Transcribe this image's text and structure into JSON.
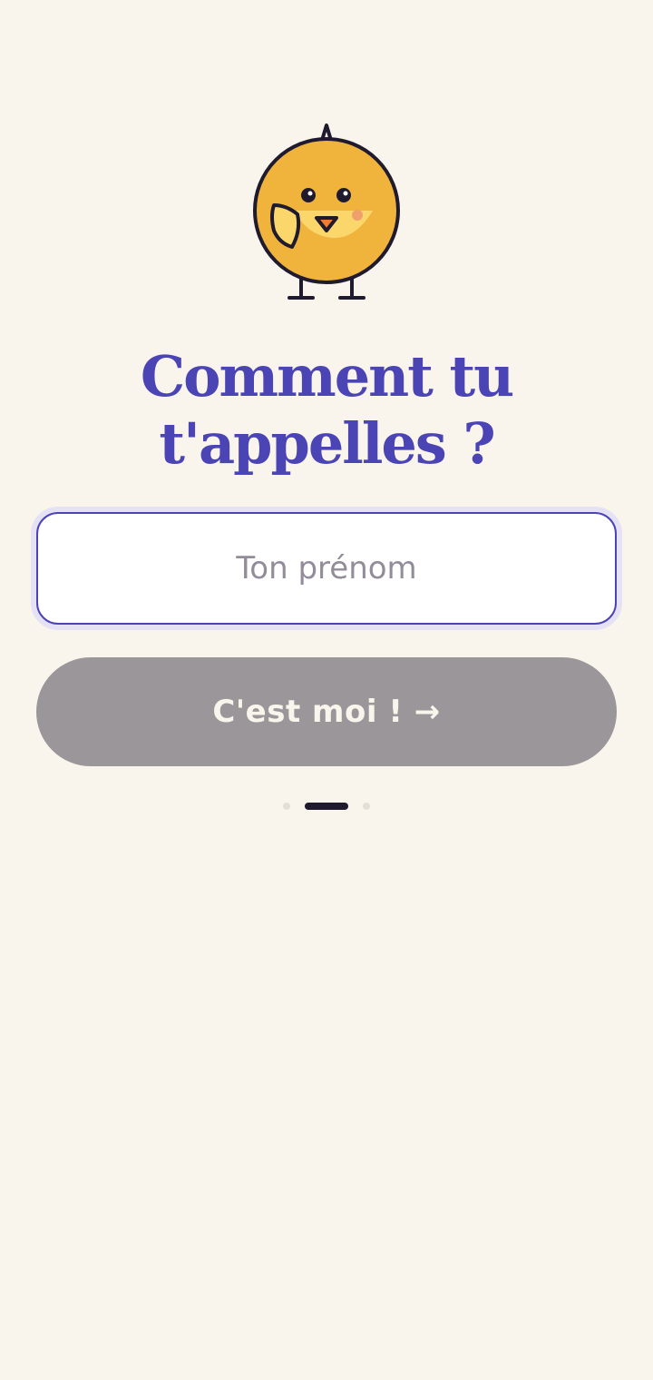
{
  "screen": {
    "title_line1": "Comment tu",
    "title_line2": "t'appelles ?"
  },
  "name_field": {
    "placeholder": "Ton prénom",
    "value": ""
  },
  "submit": {
    "label": "C'est moi ! →",
    "enabled": false
  },
  "progress": {
    "total_steps": 3,
    "current_step": 2
  },
  "icons": {
    "mascot": "chick-mascot-icon"
  },
  "colors": {
    "background": "#f9f5ec",
    "accent": "#4b44b5",
    "button_disabled": "#9a9699",
    "mascot_body": "#f0b43c"
  }
}
